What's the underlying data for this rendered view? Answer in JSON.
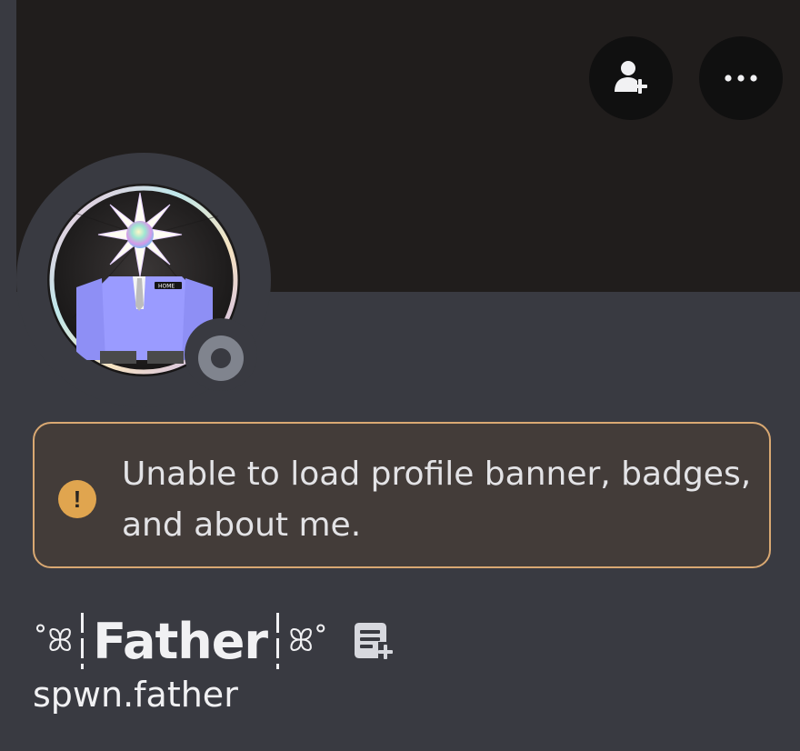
{
  "banner": {
    "color": "#201d1c"
  },
  "actions": {
    "add_friend_icon": "person-add-icon",
    "more_icon": "more-horizontal-icon"
  },
  "avatar": {
    "badge_text": "HOME",
    "status": "offline",
    "status_color": "#80848e"
  },
  "notice": {
    "icon": "exclamation-icon",
    "line1": "Unable to load profile banner, badges,",
    "line2": "and about me.",
    "border_color": "#d9a872",
    "icon_color": "#e0a54f"
  },
  "profile": {
    "deco_left": "˚ꕤ",
    "name": "Father",
    "deco_right": "ꕤ˚",
    "username": "spwn.father",
    "note_icon": "add-note-icon"
  }
}
